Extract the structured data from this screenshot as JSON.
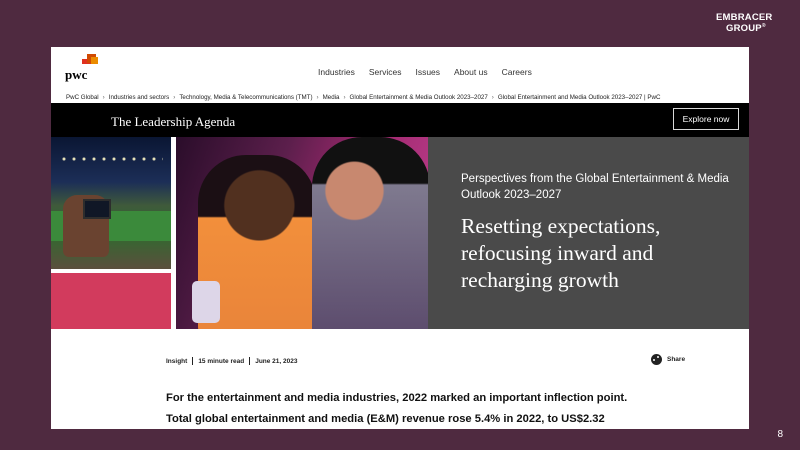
{
  "slide": {
    "brand": {
      "line1": "EMBRACER",
      "line2": "GROUP",
      "mark": "®"
    },
    "page_number": "8"
  },
  "pwc": {
    "logo_word": "pwc",
    "nav_items": [
      "Industries",
      "Services",
      "Issues",
      "About us",
      "Careers"
    ],
    "breadcrumb": [
      "PwC Global",
      "Industries and sectors",
      "Technology, Media & Telecommunications (TMT)",
      "Media",
      "Global Entertainment & Media Outlook 2023–2027",
      "Global Entertainment and Media Outlook 2023–2027 | PwC"
    ],
    "breadcrumb_separator": "›",
    "banner": {
      "title": "The Leadership Agenda",
      "button_label": "Explore now"
    },
    "hero": {
      "kicker": "Perspectives from the Global Entertainment & Media Outlook 2023–2027",
      "heading": "Resetting expectations, refocusing inward and recharging growth"
    },
    "meta": {
      "type": "Insight",
      "read_time": "15 minute read",
      "date": "June 21, 2023",
      "share_label": "Share"
    },
    "article": {
      "line1": "For the entertainment and media industries, 2022 marked an important inflection point.",
      "line2": "Total global entertainment and media (E&M) revenue rose 5.4% in 2022, to US$2.32"
    }
  },
  "colors": {
    "slide_bg": "#4f2a40",
    "pwc_orange": "#d04a02",
    "pwc_red": "#e0301e",
    "pink_block": "#d23b5d",
    "hero_panel": "#4a4a4a"
  }
}
